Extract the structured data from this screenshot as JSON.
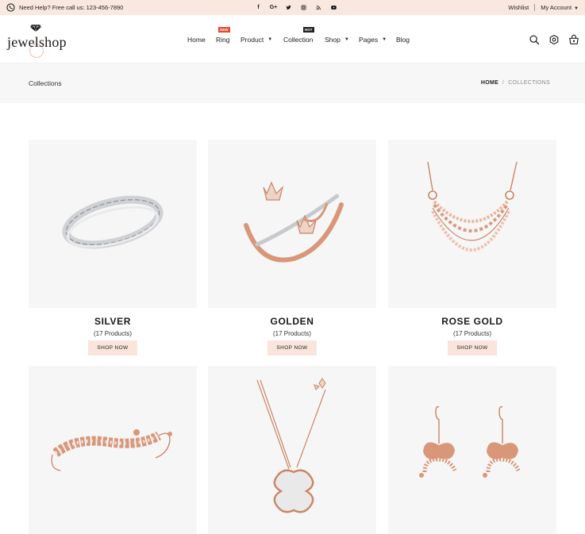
{
  "topbar": {
    "help_text": "Need Help? Free call us: 123-456-7890",
    "socials": [
      "facebook-icon",
      "google-plus-icon",
      "twitter-icon",
      "instagram-icon",
      "rss-icon",
      "youtube-icon"
    ],
    "wishlist": "Wishlist",
    "account": "My Account"
  },
  "logo": {
    "text": "jewelshop"
  },
  "nav": {
    "home": "Home",
    "ring": "Ring",
    "ring_badge": "NEW",
    "product": "Product",
    "collection": "Collection",
    "collection_badge": "HOT",
    "shop": "Shop",
    "pages": "Pages",
    "blog": "Blog"
  },
  "breadcrumb": {
    "title": "Collections",
    "home": "HOME",
    "separator": "/",
    "current": "COLLECTIONS"
  },
  "collections": [
    {
      "name": "SILVER",
      "count": "(17 Products)",
      "button": "SHOP NOW"
    },
    {
      "name": "GOLDEN",
      "count": "(17 Products)",
      "button": "SHOP NOW"
    },
    {
      "name": "ROSE GOLD",
      "count": "(17 Products)",
      "button": "SHOP NOW"
    }
  ],
  "colors": {
    "topbar_bg": "#f9e8e0",
    "button_bg": "#f9e5dc",
    "rose_gold": "#d9977a",
    "badge_new": "#e8462f"
  }
}
